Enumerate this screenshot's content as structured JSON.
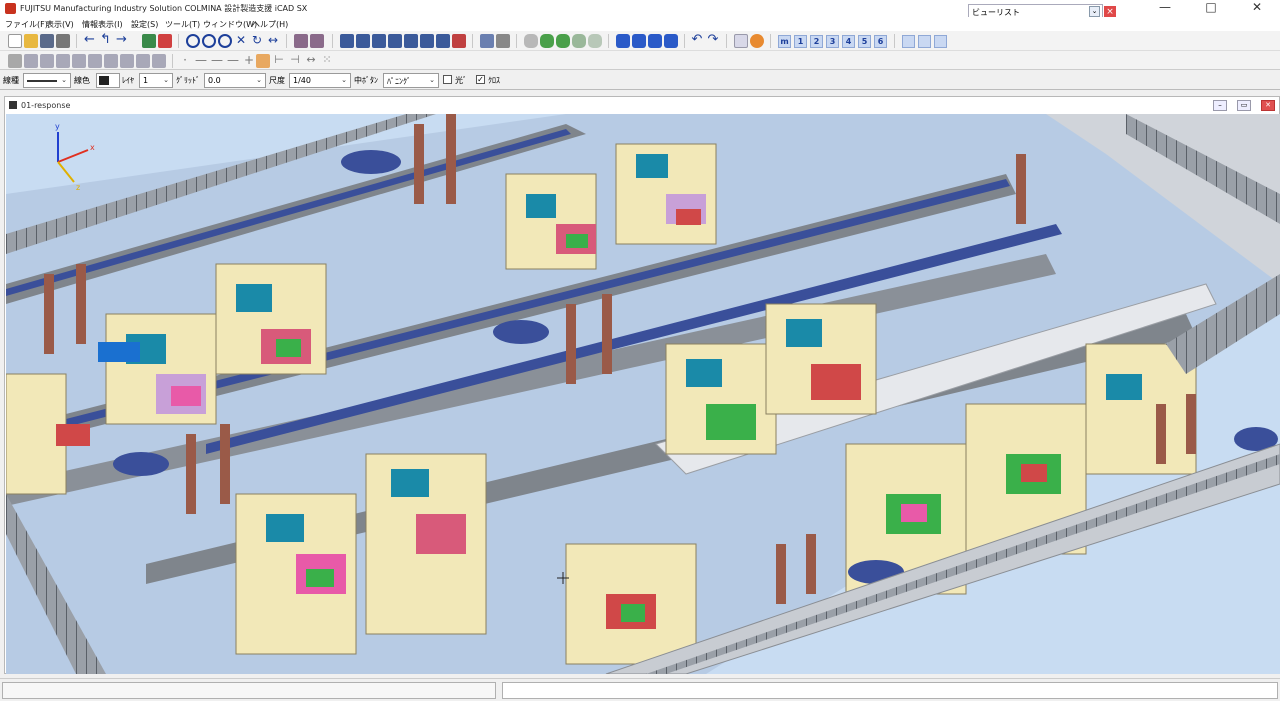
{
  "window": {
    "title": "FUJITSU Manufacturing Industry Solution COLMINA 設計製造支援 iCAD SX",
    "view_list_label": "ビューリスト",
    "view_list_close": "×",
    "minimize": "—",
    "maximize": "□",
    "close": "✕"
  },
  "menu": [
    "ファイル(F)",
    "表示(V)",
    "情報表示(I)",
    "設定(S)",
    "ツール(T)",
    "ウィンドウ(W)",
    "ヘルプ(H)"
  ],
  "toolbar": {
    "view_numbers": [
      "m",
      "1",
      "2",
      "3",
      "4",
      "5",
      "6"
    ]
  },
  "properties": {
    "line_type_label": "線種",
    "line_color_label": "線色",
    "layer_label": "ﾚｲﾔ",
    "layer_value": "1",
    "grid_label": "ｸﾞﾘｯﾄﾞ",
    "grid_value": "0.0",
    "scale_label": "尺度",
    "scale_value": "1/40",
    "middle_button_label": "中ﾎﾞﾀﾝ",
    "middle_button_value": "ﾊﾟﾆﾝｸﾞ",
    "light_label": "光ﾞ",
    "cross_label": "ｸﾛｽ",
    "cross_checked": "✓"
  },
  "document": {
    "title": "01-response",
    "axes": {
      "x": "x",
      "y": "y",
      "z": "z"
    }
  },
  "colors": {
    "viewport_bg": "#c8dcf2",
    "machine_body": "#f2e8b8",
    "frame_gray": "#8a8f96",
    "beam_blue": "#3a4f9a",
    "column_brown": "#9a5a48",
    "axis_x": "#e03020",
    "axis_y": "#2040d0",
    "axis_z": "#e0b000"
  }
}
